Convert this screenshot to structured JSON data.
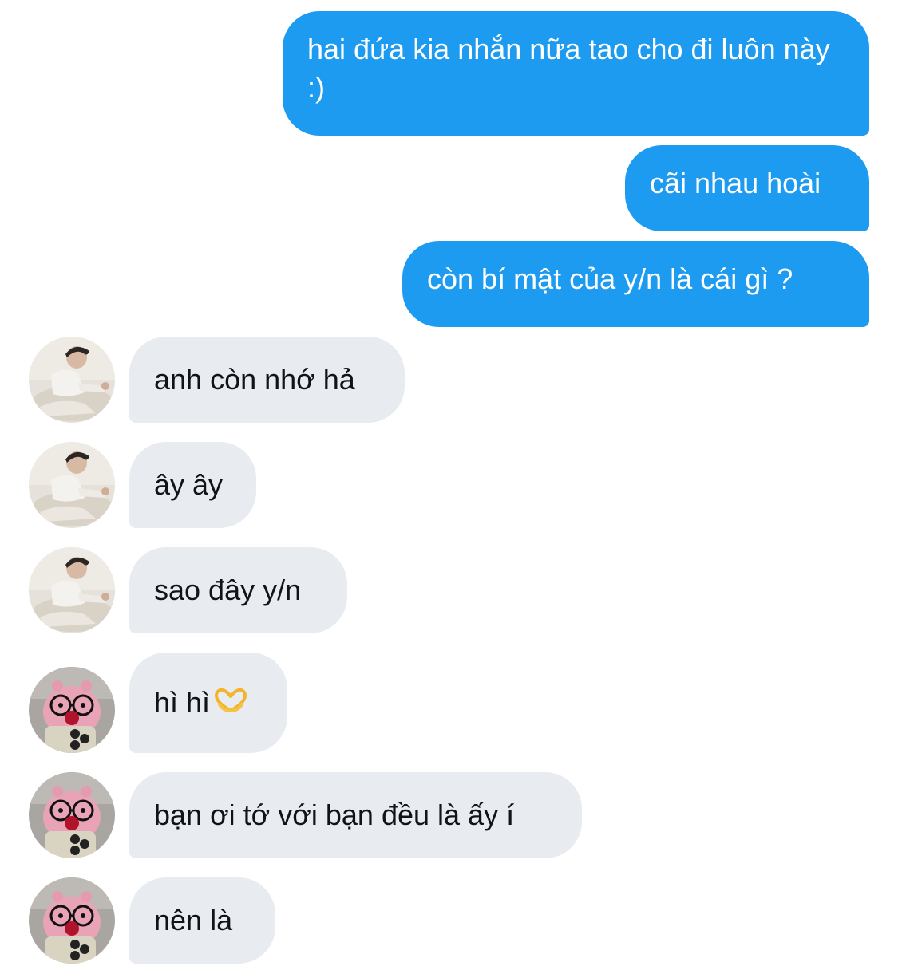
{
  "conversation": {
    "sent": [
      {
        "text": "hai đứa kia nhắn nữa tao cho đi luôn này :)"
      },
      {
        "text": "cãi nhau hoài"
      },
      {
        "text": "còn bí mật của y/n là cái gì ?"
      }
    ],
    "received": [
      {
        "text": "anh còn nhớ hả",
        "avatar": "man-in-white-avatar"
      },
      {
        "text": "ây ây",
        "avatar": "man-in-white-avatar"
      },
      {
        "text": "sao đây y/n",
        "avatar": "man-in-white-avatar"
      },
      {
        "text": "hì hì",
        "emoji": "heart-hands-emoji",
        "avatar": "pink-plush-avatar"
      },
      {
        "text": "bạn ơi tớ với bạn đều là ấy í",
        "avatar": "pink-plush-avatar"
      },
      {
        "text": "nên là",
        "avatar": "pink-plush-avatar"
      }
    ]
  },
  "colors": {
    "sent_bubble": "#1d9bf0",
    "received_bubble": "#e8ebef",
    "sent_text": "#ffffff",
    "received_text": "#0f1419"
  }
}
